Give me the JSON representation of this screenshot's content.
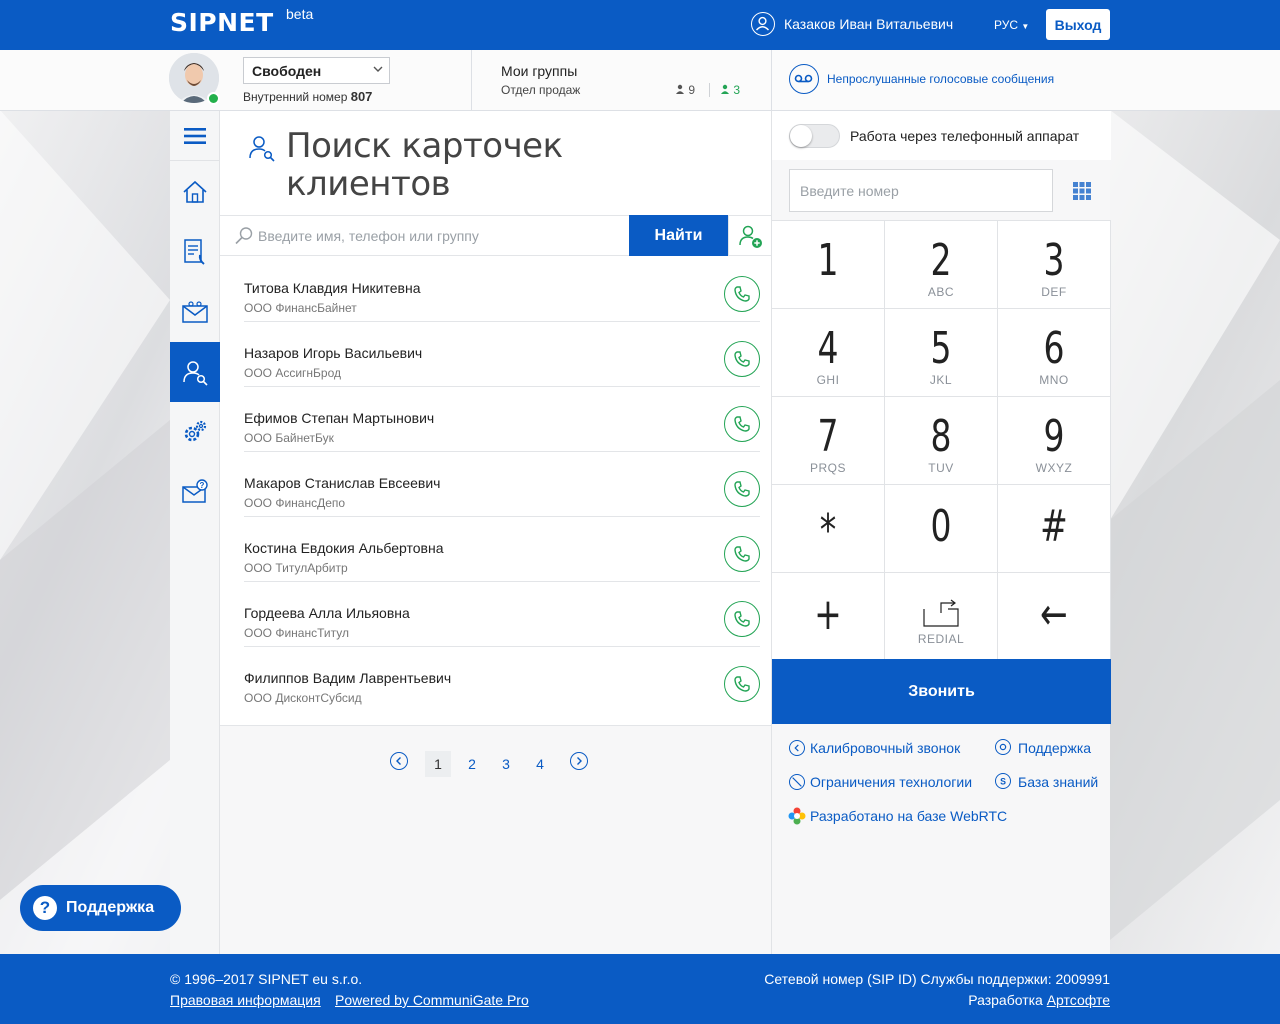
{
  "colors": {
    "brand": "#0a5bc4",
    "call_green": "#23a455",
    "online": "#23b04b"
  },
  "header": {
    "logo": "SIPNET",
    "logo_badge": "beta",
    "user_name": "Казаков Иван Витальевич",
    "language": "РУС",
    "logout_label": "Выход"
  },
  "subheader": {
    "status": "Свободен",
    "extension_label": "Внутренний номер",
    "extension_number": "807",
    "groups_title": "Мои группы",
    "groups_subtitle": "Отдел продаж",
    "group_members_total": "9",
    "group_members_online": "3",
    "voicemail_text": "Непрослушанные голосовые сообщения"
  },
  "sidebar": {
    "items": [
      {
        "icon": "menu-icon"
      },
      {
        "icon": "home-icon"
      },
      {
        "icon": "call-log-icon"
      },
      {
        "icon": "voicemail-mail-icon"
      },
      {
        "icon": "contact-search-icon"
      },
      {
        "icon": "settings-icon"
      },
      {
        "icon": "mail-help-icon"
      }
    ]
  },
  "content": {
    "title": "Поиск карточек клиентов",
    "search_placeholder": "Введите имя, телефон или группу",
    "find_label": "Найти",
    "contacts": [
      {
        "name": "Титова Клавдия Никитевна",
        "company": "ООО ФинансБайнет"
      },
      {
        "name": "Назаров Игорь Васильевич",
        "company": "ООО АссигнБрод"
      },
      {
        "name": "Ефимов Степан Мартынович",
        "company": "ООО БайнетБук"
      },
      {
        "name": "Макаров Станислав Евсеевич",
        "company": "ООО ФинансДепо"
      },
      {
        "name": "Костина Евдокия Альбертовна",
        "company": "ООО ТитулАрбитр"
      },
      {
        "name": "Гордеева Алла Ильяовна",
        "company": "ООО ФинансТитул"
      },
      {
        "name": "Филиппов Вадим Лаврентьевич",
        "company": "ООО ДисконтСубсид"
      }
    ],
    "pages": [
      "1",
      "2",
      "3",
      "4"
    ],
    "current_page": "1"
  },
  "dialer": {
    "phone_mode_label": "Работа через телефонный аппарат",
    "number_placeholder": "Введите номер",
    "keys": [
      {
        "digit": "1",
        "letters": ""
      },
      {
        "digit": "2",
        "letters": "ABC"
      },
      {
        "digit": "3",
        "letters": "DEF"
      },
      {
        "digit": "4",
        "letters": "GHI"
      },
      {
        "digit": "5",
        "letters": "JKL"
      },
      {
        "digit": "6",
        "letters": "MNO"
      },
      {
        "digit": "7",
        "letters": "PRQS"
      },
      {
        "digit": "8",
        "letters": "TUV"
      },
      {
        "digit": "9",
        "letters": "WXYZ"
      },
      {
        "digit": "*",
        "letters": ""
      },
      {
        "digit": "0",
        "letters": ""
      },
      {
        "digit": "#",
        "letters": ""
      },
      {
        "digit": "+",
        "letters": ""
      },
      {
        "digit": "",
        "letters": "REDIAL"
      },
      {
        "digit": "←",
        "letters": ""
      }
    ],
    "call_label": "Звонить",
    "links": {
      "calibration": "Калибровочный звонок",
      "support": "Поддержка",
      "restrictions": "Ограничения технологии",
      "knowledge_base": "База знаний",
      "webrtc": "Разработано на базе WebRTC"
    }
  },
  "support_pill": {
    "label": "Поддержка"
  },
  "footer": {
    "copyright": "© 1996–2017 SIPNET eu s.r.o.",
    "legal_link": "Правовая информация",
    "powered_link": "Powered by CommuniGate Pro",
    "sip_id_text": "Сетевой номер (SIP ID) Службы поддержки: 2009991",
    "dev_prefix": "Разработка",
    "dev_link": "Артсофте"
  }
}
